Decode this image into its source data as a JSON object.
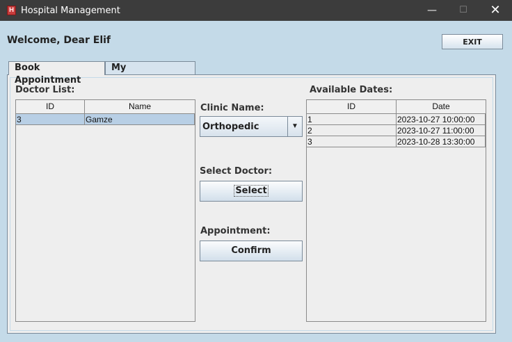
{
  "window": {
    "title": "Hospital Management",
    "icon": "H",
    "controls": {
      "minimize": "—",
      "maximize": "☐",
      "close": "✕"
    }
  },
  "header": {
    "welcome": "Welcome, Dear Elif",
    "exit_label": "EXIT"
  },
  "tabs": [
    {
      "label": "Book Appointment",
      "selected": true
    },
    {
      "label": "My Appointments",
      "selected": false
    }
  ],
  "doctor_list": {
    "label": "Doctor List:",
    "columns": [
      "ID",
      "Name"
    ],
    "rows": [
      {
        "id": "3",
        "name": "Gamze",
        "selected": true
      }
    ]
  },
  "clinic": {
    "label": "Clinic Name:",
    "selected": "Orthopedic"
  },
  "select_doctor": {
    "label": "Select Doctor:",
    "button": "Select"
  },
  "appointment": {
    "label": "Appointment:",
    "button": "Confirm"
  },
  "available_dates": {
    "label": "Available Dates:",
    "columns": [
      "ID",
      "Date"
    ],
    "rows": [
      {
        "id": "1",
        "date": "2023-10-27 10:00:00"
      },
      {
        "id": "2",
        "date": "2023-10-27 11:00:00"
      },
      {
        "id": "3",
        "date": "2023-10-28 13:30:00"
      }
    ]
  },
  "colors": {
    "window_bg": "#c4dae8",
    "titlebar": "#3c3c3c",
    "selection": "#b8cfe5"
  }
}
